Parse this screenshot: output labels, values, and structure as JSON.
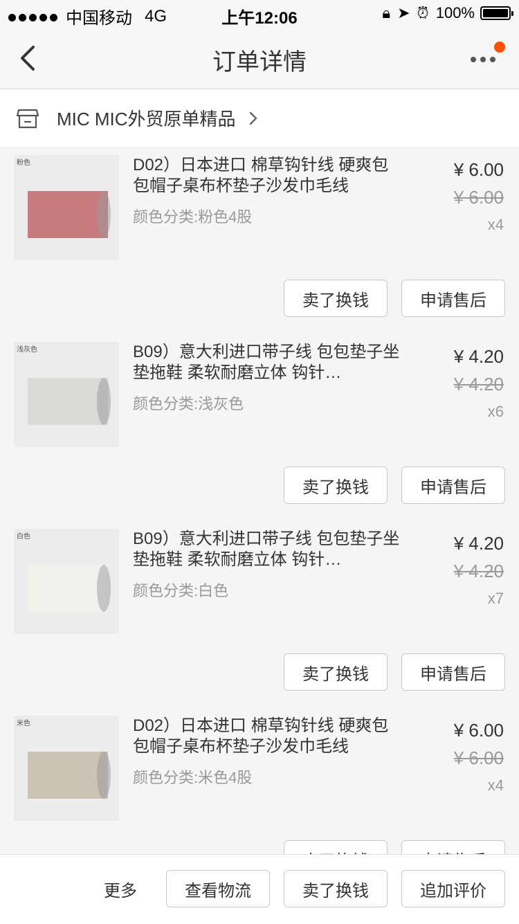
{
  "status_bar": {
    "carrier": "中国移动",
    "network": "4G",
    "time": "上午12:06",
    "battery": "100%"
  },
  "nav": {
    "title": "订单详情",
    "badge_color": "#ff5000"
  },
  "shop": {
    "name": "MIC MIC外贸原单精品"
  },
  "items": [
    {
      "image_tag": "粉色",
      "image_color": "#c97a7e",
      "title": "D02）日本进口 棉草钩针线 硬爽包包帽子桌布杯垫子沙发巾毛线",
      "sku": "颜色分类:粉色4股",
      "price": "¥ 6.00",
      "original_price": "¥ 6.00",
      "qty": "x4",
      "sell_label": "卖了换钱",
      "after_sale_label": "申请售后"
    },
    {
      "image_tag": "浅灰色",
      "image_color": "#d9d9d6",
      "title": "B09）意大利进口带子线 包包垫子坐垫拖鞋 柔软耐磨立体 钩针…",
      "sku": "颜色分类:浅灰色",
      "price": "¥ 4.20",
      "original_price": "¥ 4.20",
      "qty": "x6",
      "sell_label": "卖了换钱",
      "after_sale_label": "申请售后"
    },
    {
      "image_tag": "白色",
      "image_color": "#f2f1ec",
      "title": "B09）意大利进口带子线 包包垫子坐垫拖鞋 柔软耐磨立体 钩针…",
      "sku": "颜色分类:白色",
      "price": "¥ 4.20",
      "original_price": "¥ 4.20",
      "qty": "x7",
      "sell_label": "卖了换钱",
      "after_sale_label": "申请售后"
    },
    {
      "image_tag": "米色",
      "image_color": "#cbc3b4",
      "title": "D02）日本进口 棉草钩针线 硬爽包包帽子桌布杯垫子沙发巾毛线",
      "sku": "颜色分类:米色4股",
      "price": "¥ 6.00",
      "original_price": "¥ 6.00",
      "qty": "x4",
      "sell_label": "卖了换钱",
      "after_sale_label": "申请售后"
    }
  ],
  "bottom_bar": {
    "more": "更多",
    "logistics": "查看物流",
    "sell": "卖了换钱",
    "review": "追加评价"
  },
  "icons": {
    "back": "chevron-left-icon",
    "more": "ellipsis-icon",
    "shop": "store-icon",
    "shop_chevron": "chevron-right-icon"
  }
}
